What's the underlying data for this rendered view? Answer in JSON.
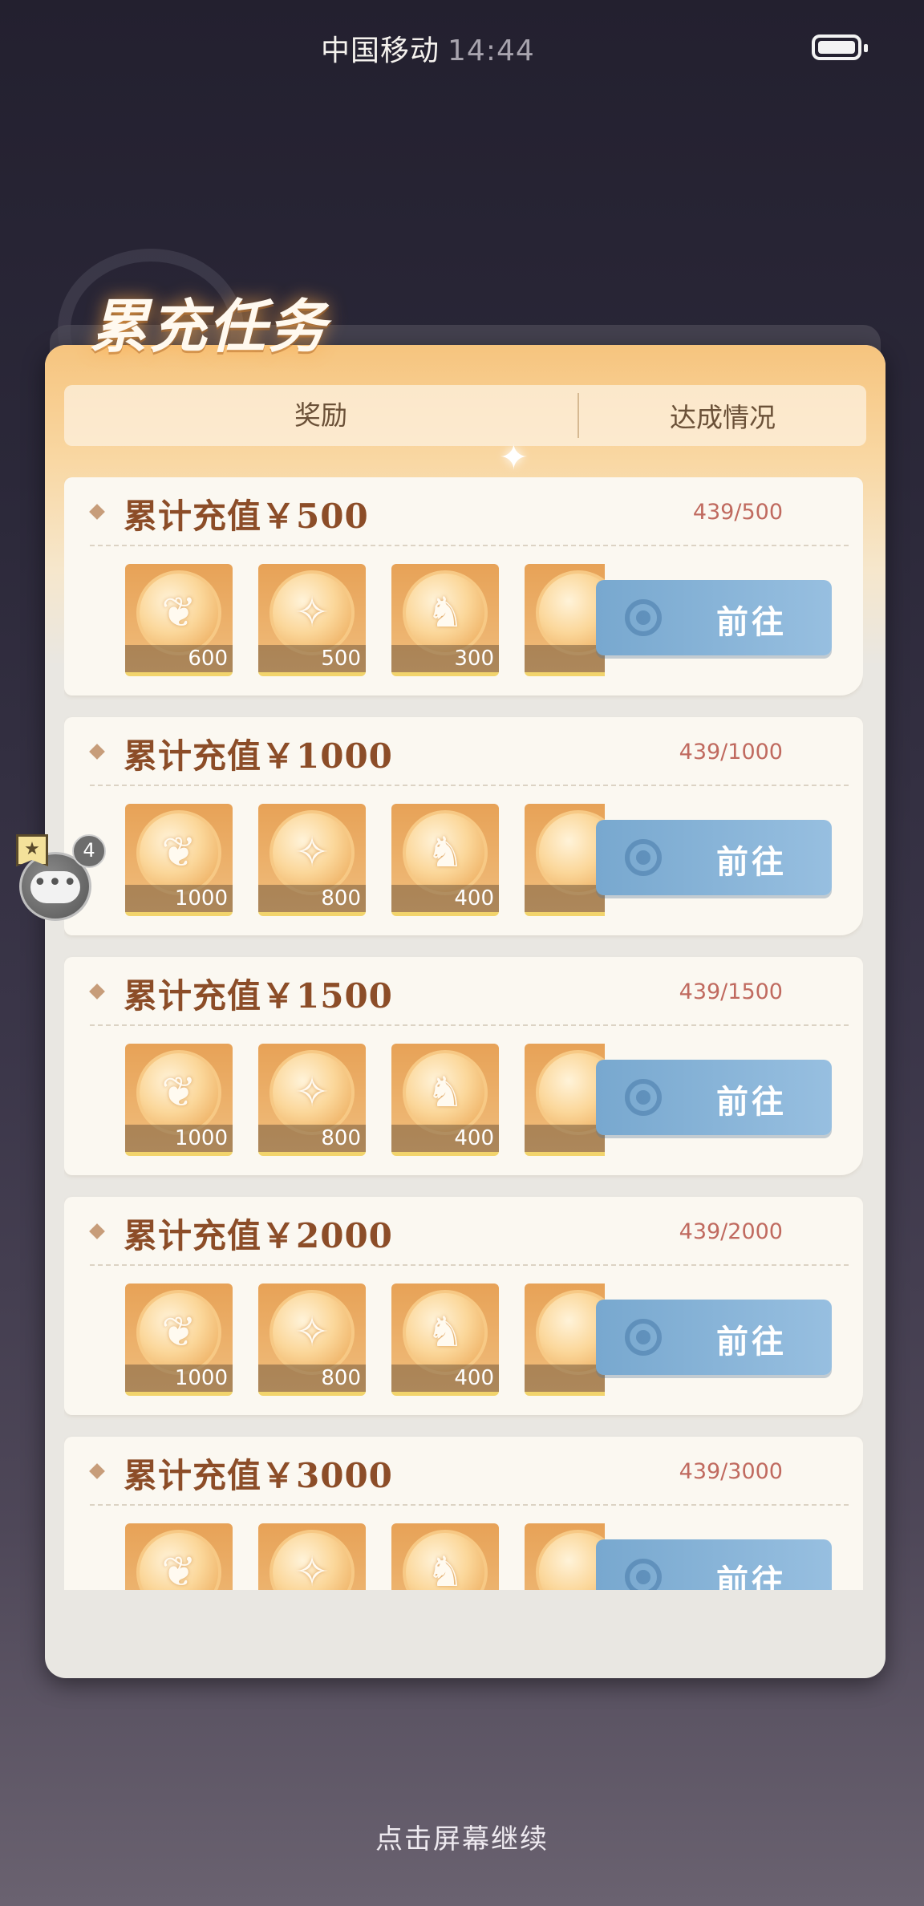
{
  "status_bar": {
    "carrier": "中国移动",
    "time": "14:44"
  },
  "panel": {
    "title": "累充任务",
    "header": {
      "reward_col": "奖励",
      "status_col": "达成情况"
    }
  },
  "tasks": [
    {
      "title": "累计充值￥500",
      "progress": "439/500",
      "button": "前往",
      "rewards": [
        {
          "icon": "scroll-coin-icon",
          "qty": "600"
        },
        {
          "icon": "sword-coin-icon",
          "qty": "500"
        },
        {
          "icon": "dragon-coin-icon",
          "qty": "300"
        }
      ]
    },
    {
      "title": "累计充值￥1000",
      "progress": "439/1000",
      "button": "前往",
      "rewards": [
        {
          "icon": "scroll-coin-icon",
          "qty": "1000"
        },
        {
          "icon": "sword-coin-icon",
          "qty": "800"
        },
        {
          "icon": "dragon-coin-icon",
          "qty": "400"
        }
      ]
    },
    {
      "title": "累计充值￥1500",
      "progress": "439/1500",
      "button": "前往",
      "rewards": [
        {
          "icon": "scroll-coin-icon",
          "qty": "1000"
        },
        {
          "icon": "sword-coin-icon",
          "qty": "800"
        },
        {
          "icon": "dragon-coin-icon",
          "qty": "400"
        }
      ]
    },
    {
      "title": "累计充值￥2000",
      "progress": "439/2000",
      "button": "前往",
      "rewards": [
        {
          "icon": "scroll-coin-icon",
          "qty": "1000"
        },
        {
          "icon": "sword-coin-icon",
          "qty": "800"
        },
        {
          "icon": "dragon-coin-icon",
          "qty": "400"
        }
      ]
    },
    {
      "title": "累计充值￥3000",
      "progress": "439/3000",
      "button": "前往",
      "rewards": [
        {
          "icon": "scroll-coin-icon",
          "qty": ""
        },
        {
          "icon": "sword-coin-icon",
          "qty": ""
        },
        {
          "icon": "dragon-coin-icon",
          "qty": ""
        }
      ]
    }
  ],
  "chat_widget": {
    "badge_count": "4"
  },
  "footer": {
    "continue_hint": "点击屏幕继续"
  },
  "colors": {
    "title_text": "#8c4d28",
    "progress_text": "#c06a5f",
    "goto_button": "#88b4d8",
    "panel_accent": "#f6c47e"
  }
}
